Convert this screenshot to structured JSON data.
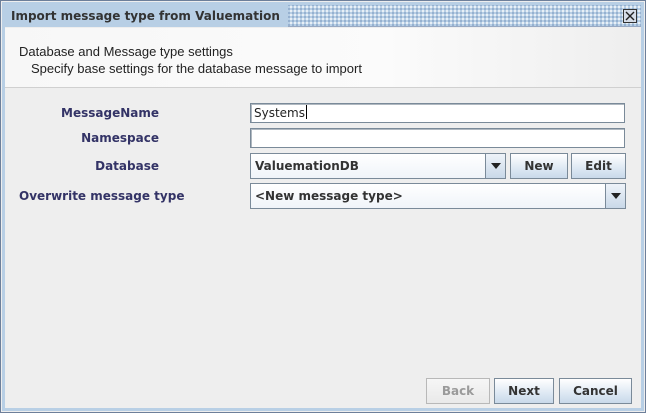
{
  "window": {
    "title": "Import message type from Valuemation"
  },
  "header": {
    "title": "Database and Message type settings",
    "subtitle": "Specify base settings for the database message to import"
  },
  "form": {
    "message_name": {
      "label": "MessageName",
      "value": "Systems"
    },
    "namespace": {
      "label": "Namespace",
      "value": ""
    },
    "database": {
      "label": "Database",
      "selected": "ValuemationDB",
      "new_label": "New",
      "edit_label": "Edit"
    },
    "overwrite": {
      "label": "Overwrite message type",
      "selected": "<New message type>"
    }
  },
  "footer": {
    "back_label": "Back",
    "next_label": "Next",
    "cancel_label": "Cancel"
  },
  "icons": {
    "close": "close-icon",
    "dropdown": "chevron-down-icon"
  },
  "colors": {
    "title_bar": "#b8cfe5",
    "label_text": "#333366",
    "window_bg": "#eeeeee"
  }
}
